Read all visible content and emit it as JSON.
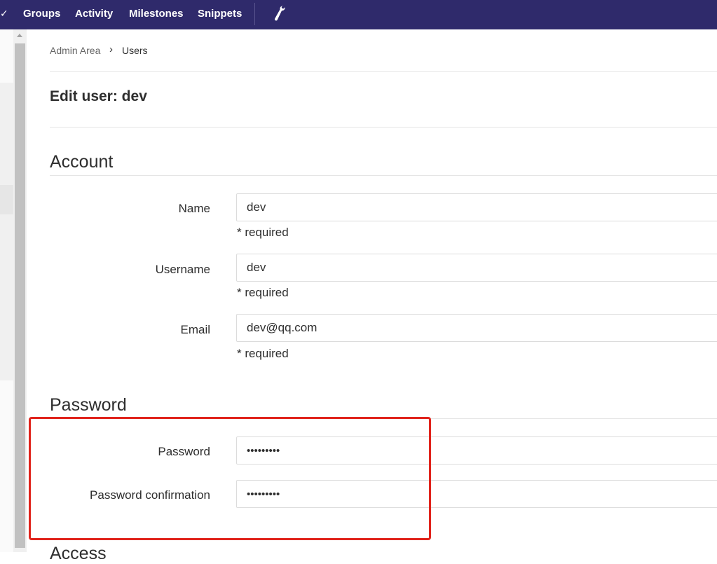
{
  "topnav": {
    "chevron": "✓",
    "items": [
      {
        "label": "Groups"
      },
      {
        "label": "Activity"
      },
      {
        "label": "Milestones"
      },
      {
        "label": "Snippets"
      }
    ],
    "admin_icon": "wrench-icon"
  },
  "breadcrumb": {
    "parent": "Admin Area",
    "separator": "›",
    "current": "Users"
  },
  "page": {
    "title": "Edit user: dev"
  },
  "account": {
    "title": "Account",
    "fields": [
      {
        "label": "Name",
        "value": "dev",
        "help": "* required"
      },
      {
        "label": "Username",
        "value": "dev",
        "help": "* required"
      },
      {
        "label": "Email",
        "value": "dev@qq.com",
        "help": "* required"
      }
    ]
  },
  "password": {
    "title": "Password",
    "fields": [
      {
        "label": "Password",
        "value": "•••••••••"
      },
      {
        "label": "Password confirmation",
        "value": "•••••••••"
      }
    ]
  },
  "next_section": {
    "title": "Access"
  },
  "colors": {
    "navbar": "#2f2a6b",
    "highlight": "#e0241c"
  }
}
